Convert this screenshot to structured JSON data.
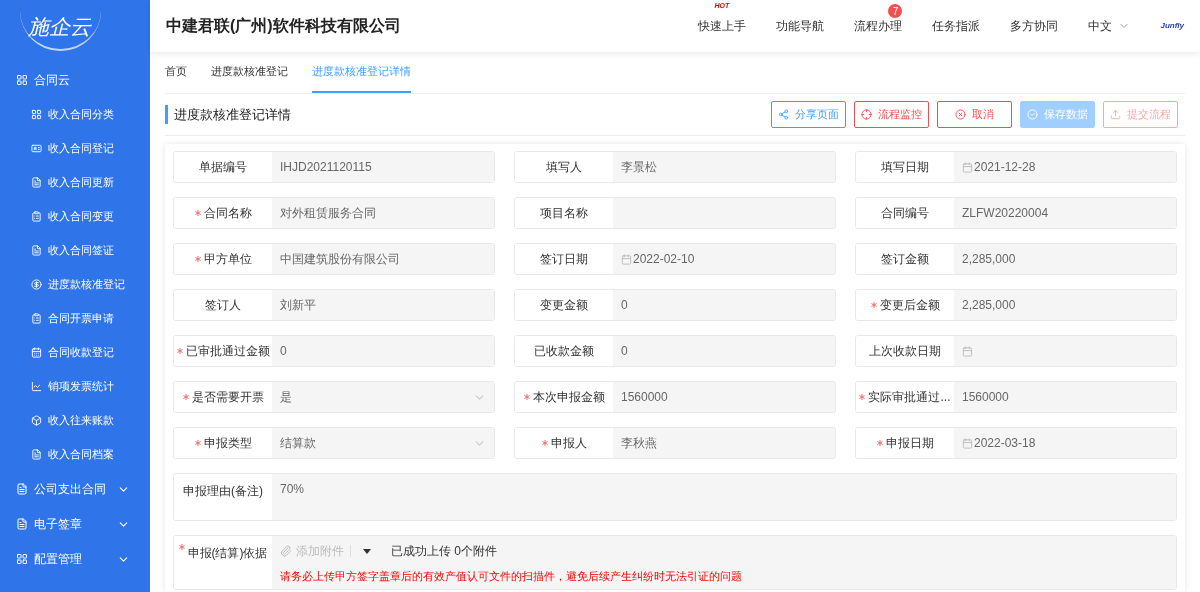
{
  "sidebar": {
    "logo": "施企云",
    "groups": [
      {
        "label": "合同云",
        "expanded": true,
        "items": [
          {
            "label": "收入合同分类"
          },
          {
            "label": "收入合同登记"
          },
          {
            "label": "收入合同更新"
          },
          {
            "label": "收入合同变更"
          },
          {
            "label": "收入合同签证"
          },
          {
            "label": "进度款核准登记"
          },
          {
            "label": "合同开票申请"
          },
          {
            "label": "合同收款登记"
          },
          {
            "label": "销项发票统计"
          },
          {
            "label": "收入往来账款"
          },
          {
            "label": "收入合同档案"
          }
        ]
      },
      {
        "label": "公司支出合同",
        "expanded": false
      },
      {
        "label": "电子签章",
        "expanded": false
      },
      {
        "label": "配置管理",
        "expanded": false
      }
    ]
  },
  "header": {
    "company": "中建君联(广州)软件科技有限公司",
    "nav": [
      {
        "label": "快速上手",
        "hot": "HOT"
      },
      {
        "label": "功能导航"
      },
      {
        "label": "流程办理",
        "badge": "7"
      },
      {
        "label": "任务指派"
      },
      {
        "label": "多方协同"
      }
    ],
    "language": "中文",
    "logo": "Junfly"
  },
  "tabs": [
    {
      "label": "首页",
      "selected": false
    },
    {
      "label": "进度款核准登记",
      "selected": false
    },
    {
      "label": "进度款核准登记详情",
      "selected": true
    }
  ],
  "page_title": "进度款核准登记详情",
  "actions": [
    {
      "label": "分享页面",
      "kind": "primary-outline",
      "disabled": false
    },
    {
      "label": "流程监控",
      "kind": "danger-outline",
      "disabled": false
    },
    {
      "label": "取消",
      "kind": "danger-outline",
      "disabled": false
    },
    {
      "label": "保存数据",
      "kind": "primary",
      "disabled": true
    },
    {
      "label": "提交流程",
      "kind": "danger-outline",
      "disabled": true
    }
  ],
  "form": {
    "fields": [
      {
        "label": "单据编号",
        "kind": "text",
        "required": false,
        "value": "IHJD2021120115"
      },
      {
        "label": "填写人",
        "kind": "text",
        "required": false,
        "value": "李景松"
      },
      {
        "label": "填写日期",
        "kind": "date",
        "required": false,
        "value": "2021-12-28"
      },
      {
        "label": "合同名称",
        "kind": "text",
        "required": true,
        "value": "对外租赁服务合同"
      },
      {
        "label": "项目名称",
        "kind": "text",
        "required": false
      },
      {
        "label": "合同编号",
        "kind": "text",
        "required": false,
        "value": "ZLFW20220004"
      },
      {
        "label": "甲方单位",
        "kind": "text",
        "required": true,
        "value": "中国建筑股份有限公司"
      },
      {
        "label": "签订日期",
        "kind": "date",
        "required": false,
        "value": "2022-02-10"
      },
      {
        "label": "签订金额",
        "kind": "text",
        "required": false,
        "value": "2,285,000"
      },
      {
        "label": "签订人",
        "kind": "text",
        "required": false,
        "value": "刘新平"
      },
      {
        "label": "变更金额",
        "kind": "text",
        "required": false,
        "value": "0"
      },
      {
        "label": "变更后金额",
        "kind": "text",
        "required": true,
        "value": "2,285,000"
      },
      {
        "label": "已审批通过金额",
        "kind": "text",
        "required": true,
        "value": "0"
      },
      {
        "label": "已收款金额",
        "kind": "text",
        "required": false,
        "value": "0"
      },
      {
        "label": "上次收款日期",
        "kind": "date",
        "required": false
      },
      {
        "label": "是否需要开票",
        "kind": "select",
        "required": true,
        "value": "是"
      },
      {
        "label": "本次申报金额",
        "kind": "text",
        "required": true,
        "value": "1560000"
      },
      {
        "label": "实际审批通过...",
        "kind": "text",
        "required": true,
        "value": "1560000"
      },
      {
        "label": "申报类型",
        "kind": "select",
        "required": true,
        "value": "结算款"
      },
      {
        "label": "申报人",
        "kind": "text",
        "required": true,
        "value": "李秋燕"
      },
      {
        "label": "申报日期",
        "kind": "date",
        "required": true,
        "value": "2022-03-18"
      },
      {
        "label": "申报理由(备注)",
        "kind": "textarea",
        "required": false,
        "value": "70%"
      },
      {
        "label": "申报(结算)依据",
        "kind": "upload",
        "required": true,
        "add_label": "添加附件",
        "status": "已成功上传 0个附件",
        "warning": "请务必上传甲方签字盖章后的有效产值认可文件的扫描件，避免后续产生纠纷时无法引证的问题"
      }
    ]
  }
}
